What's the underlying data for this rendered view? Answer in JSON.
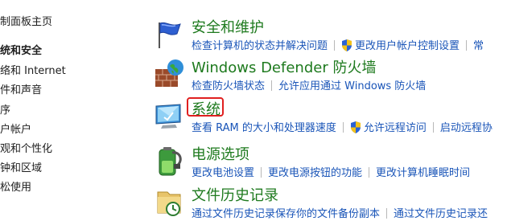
{
  "sidebar": {
    "items": [
      {
        "label": "制面板主页",
        "bold": false
      },
      {
        "label": "统和安全",
        "bold": true
      },
      {
        "label": "络和 Internet",
        "bold": false
      },
      {
        "label": "件和声音",
        "bold": false
      },
      {
        "label": "序",
        "bold": false
      },
      {
        "label": "户帐户",
        "bold": false
      },
      {
        "label": "观和个性化",
        "bold": false
      },
      {
        "label": "钟和区域",
        "bold": false
      },
      {
        "label": "松使用",
        "bold": false
      }
    ]
  },
  "categories": [
    {
      "title": "安全和维护",
      "links": [
        "检查计算机的状态并解决问题",
        "更改用户帐户控制设置",
        "常"
      ]
    },
    {
      "title": "Windows Defender 防火墙",
      "links": [
        "检查防火墙状态",
        "允许应用通过 Windows 防火墙"
      ]
    },
    {
      "title": "系统",
      "links": [
        "查看 RAM 的大小和处理器速度",
        "允许远程访问",
        "启动远程协"
      ]
    },
    {
      "title": "电源选项",
      "links": [
        "更改电池设置",
        "更改电源按钮的功能",
        "更改计算机睡眠时间"
      ]
    },
    {
      "title": "文件历史记录",
      "links": [
        "通过文件历史记录保存你的文件备份副本",
        "通过文件历史记录还"
      ]
    }
  ],
  "colors": {
    "title_green": "#1e7a1e",
    "link_blue": "#1a55b8",
    "highlight_red": "#e02020"
  }
}
